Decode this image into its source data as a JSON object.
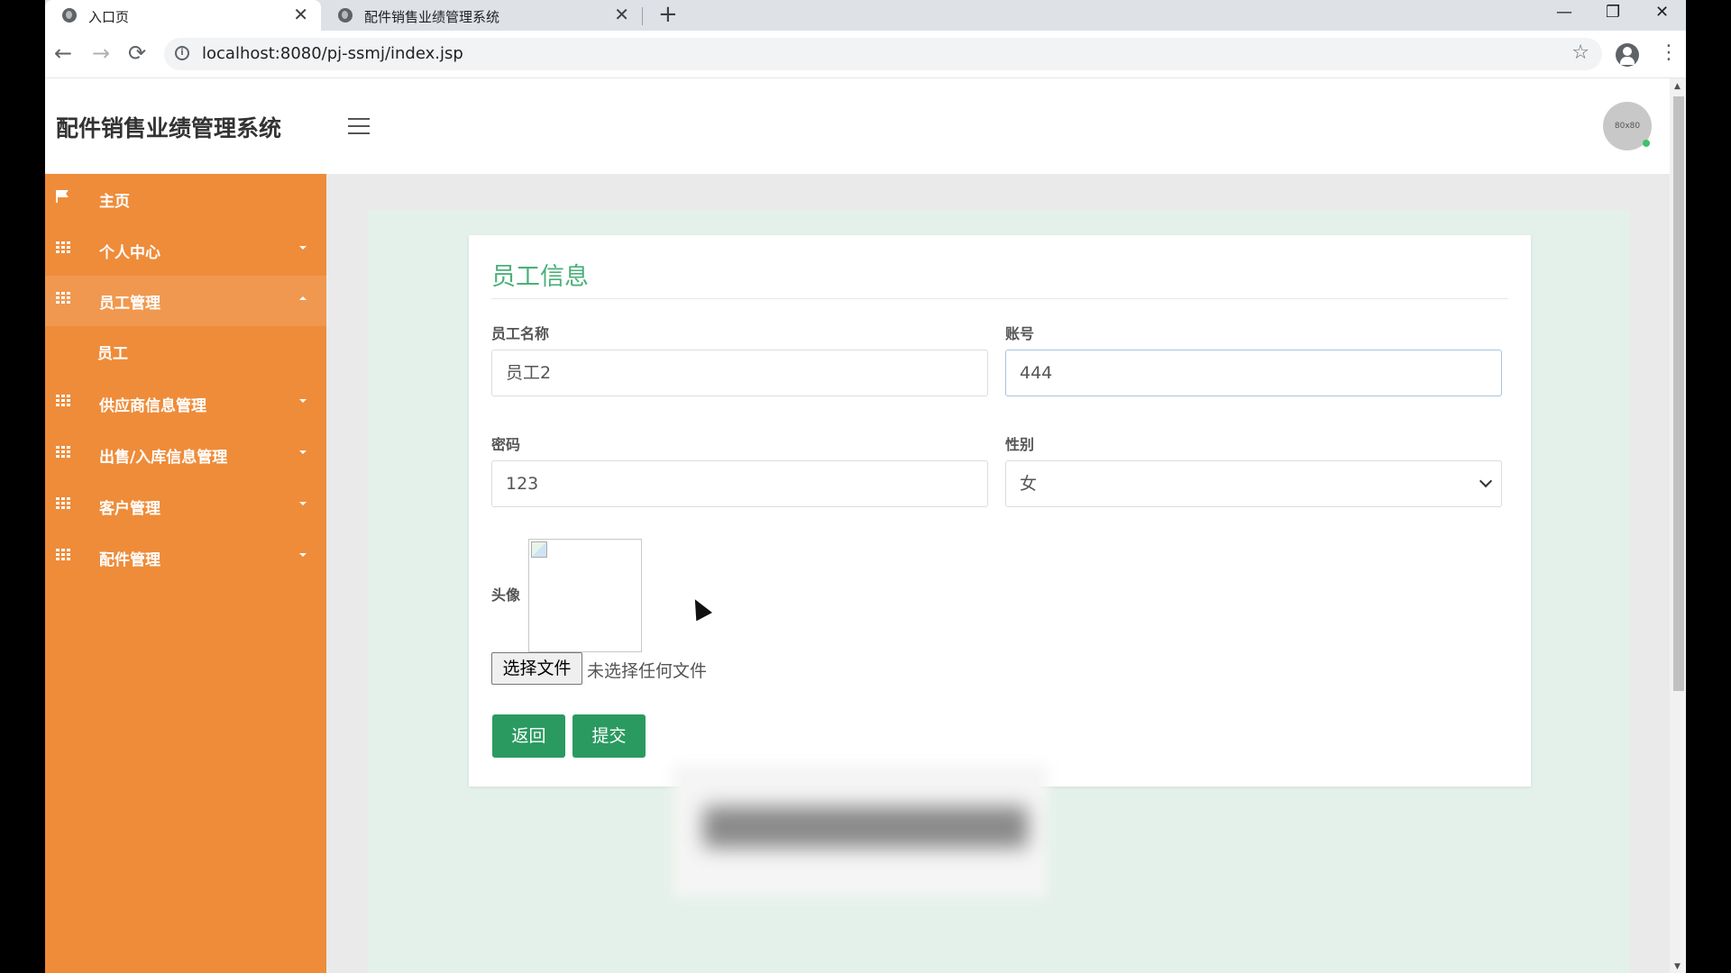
{
  "browser": {
    "tabs": [
      {
        "title": "入口页",
        "close": "✕"
      },
      {
        "title": "配件销售业绩管理系统",
        "close": "✕"
      }
    ],
    "new_tab": "+",
    "window_controls": {
      "minimize": "—",
      "restore": "❐",
      "close": "✕"
    },
    "nav": {
      "back": "←",
      "forward": "→",
      "reload": "⟳"
    },
    "url": "localhost:8080/pj-ssmj/index.jsp",
    "bookmark": "☆",
    "menu": "⋮"
  },
  "header": {
    "title": "配件销售业绩管理系统",
    "avatar_text": "80x80"
  },
  "sidebar": {
    "items": [
      {
        "label": "主页",
        "icon": "flag-icon"
      },
      {
        "label": "个人中心",
        "icon": "grid-icon"
      },
      {
        "label": "员工管理",
        "icon": "grid-icon",
        "expanded": true,
        "children": [
          {
            "label": "员工"
          }
        ]
      },
      {
        "label": "供应商信息管理",
        "icon": "grid-icon"
      },
      {
        "label": "出售/入库信息管理",
        "icon": "grid-icon"
      },
      {
        "label": "客户管理",
        "icon": "grid-icon"
      },
      {
        "label": "配件管理",
        "icon": "grid-icon"
      }
    ],
    "color": "#ee8c3a"
  },
  "form": {
    "title": "员工信息",
    "fields": {
      "name": {
        "label": "员工名称",
        "value": "员工2"
      },
      "account": {
        "label": "账号",
        "value": "444"
      },
      "password": {
        "label": "密码",
        "value": "123"
      },
      "gender": {
        "label": "性别",
        "value": "女"
      }
    },
    "avatar_label": "头像",
    "file_button": "选择文件",
    "file_status": "未选择任何文件",
    "buttons": {
      "back": "返回",
      "submit": "提交"
    },
    "accent": "#4caf7a",
    "button_color": "#2a9a60"
  }
}
